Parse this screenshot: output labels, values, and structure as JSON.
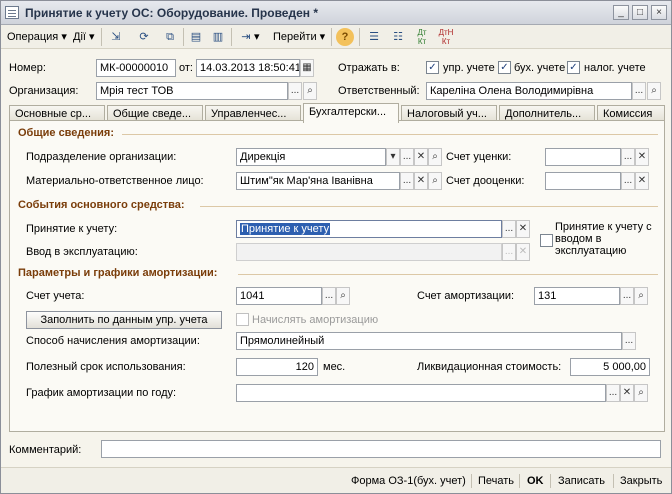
{
  "window": {
    "title": "Принятие к учету ОС: Оборудование. Проведен *",
    "minimize": "_",
    "maximize": "□",
    "close": "×"
  },
  "toolbar": {
    "operation": "Операция",
    "actions": "Дії",
    "goto": "Перейти",
    "help": "?",
    "dropdown_arrow": "▾",
    "dt_kt_1": "Дт Кт",
    "dt_kt_2": "ДтН Кт"
  },
  "header": {
    "number_label": "Номер:",
    "number_value": "МК-00000010",
    "date_label": "от:",
    "date_value": "14.03.2013 18:50:41",
    "reflect_label": "Отражать в:",
    "reflect_mgmt": "упр. учете",
    "reflect_acc": "бух. учете",
    "reflect_tax": "налог. учете",
    "org_label": "Организация:",
    "org_value": "Мрія тест ТОВ",
    "responsible_label": "Ответственный:",
    "responsible_value": "Кареліна Олена Володимирівна"
  },
  "tabs": [
    "Основные ср...",
    "Общие сведе...",
    "Управленчес...",
    "Бухгалтерски...",
    "Налоговый уч...",
    "Дополнитель...",
    "Комиссия"
  ],
  "general": {
    "title": "Общие сведения:",
    "division_label": "Подразделение организации:",
    "division_value": "Дирекція",
    "mol_label": "Материально-ответственное лицо:",
    "mol_value": "Штим\"як Мар'яна Іванівна",
    "valuation_label": "Счет уценки:",
    "revaluation_label": "Счет дооценки:"
  },
  "events": {
    "title": "События основного средства:",
    "accept_label": "Принятие к учету:",
    "accept_value": "Принятие к учету",
    "commission_label": "Ввод в эксплуатацию:",
    "with_commission_label": "Принятие к учету с вводом в эксплуатацию"
  },
  "amort": {
    "title": "Параметры и графики амортизации:",
    "account_label": "Счет учета:",
    "account_value": "1041",
    "amort_account_label": "Счет амортизации:",
    "amort_account_value": "131",
    "fill_button": "Заполнить по данным упр. учета",
    "charge_amort_label": "Начислять амортизацию",
    "method_label": "Способ начисления амортизации:",
    "method_value": "Прямолинейный",
    "useful_life_label": "Полезный срок использования:",
    "useful_life_value": "120",
    "months_label": "мес.",
    "liquidation_label": "Ликвидационная стоимость:",
    "liquidation_value": "5 000,00",
    "schedule_label": "График амортизации по году:"
  },
  "comment": {
    "label": "Комментарий:",
    "value": ""
  },
  "status": {
    "print_form": "Форма ОЗ-1(бух. учет)",
    "print": "Печать",
    "ok": "OK",
    "save": "Записать",
    "close": "Закрыть"
  },
  "glyphs": {
    "ellipsis": "...",
    "clear": "✕",
    "search": "⌕",
    "arrow_down": "▾",
    "calendar": "▦",
    "check": "✓"
  }
}
